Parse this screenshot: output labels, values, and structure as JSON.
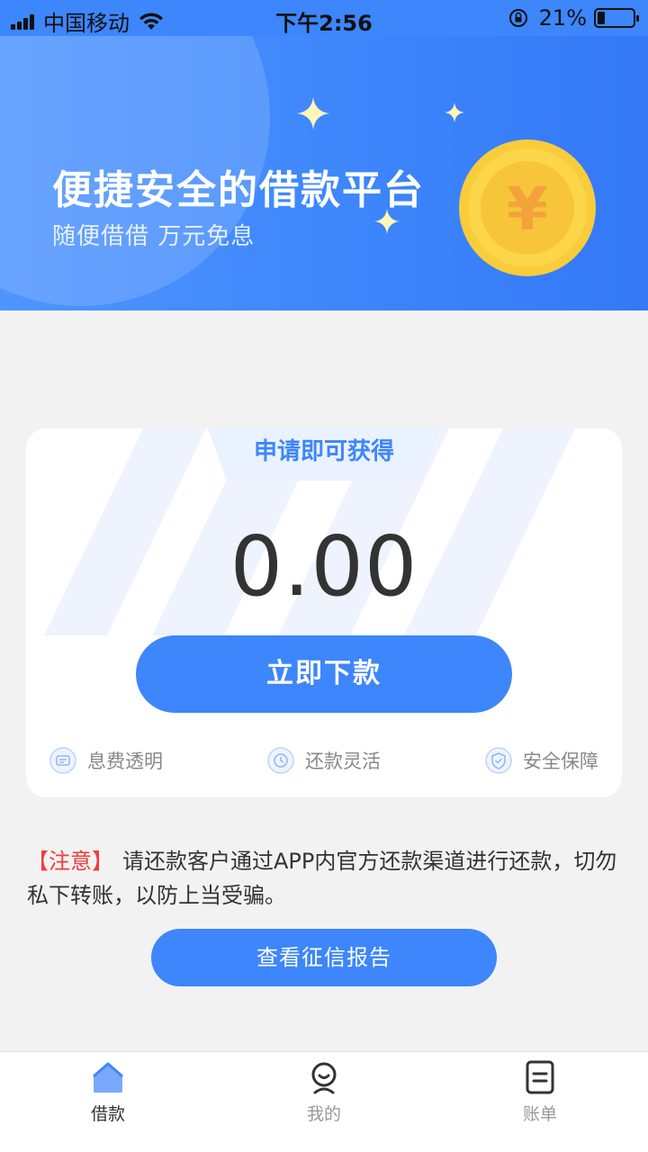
{
  "status_bar": {
    "carrier": "中国移动",
    "time": "下午2:56",
    "battery": "21%",
    "battery_level": 0.21
  },
  "banner": {
    "title": "便捷安全的借款平台",
    "subtitle": "随便借借 万元免息",
    "coin_symbol": "¥"
  },
  "card": {
    "tab_label": "申请即可获得",
    "amount": "0.00",
    "borrow_button": "立即下款",
    "features": [
      {
        "icon": "document-icon",
        "label": "息费透明"
      },
      {
        "icon": "clock-icon",
        "label": "还款灵活"
      },
      {
        "icon": "shield-icon",
        "label": "安全保障"
      }
    ]
  },
  "notice": {
    "tag": "【注意】",
    "text": "请还款客户通过APP内官方还款渠道进行还款，切勿私下转账，以防上当受骗。"
  },
  "report_button": "查看征信报告",
  "tab_bar": {
    "items": [
      {
        "label": "借款",
        "icon": "home-icon",
        "active": true
      },
      {
        "label": "我的",
        "icon": "user-icon",
        "active": false
      },
      {
        "label": "账单",
        "icon": "bill-icon",
        "active": false
      }
    ]
  },
  "colors": {
    "primary": "#3d86fb",
    "notice_red": "#f03c3c",
    "coin_gold": "#f8cc3a"
  }
}
